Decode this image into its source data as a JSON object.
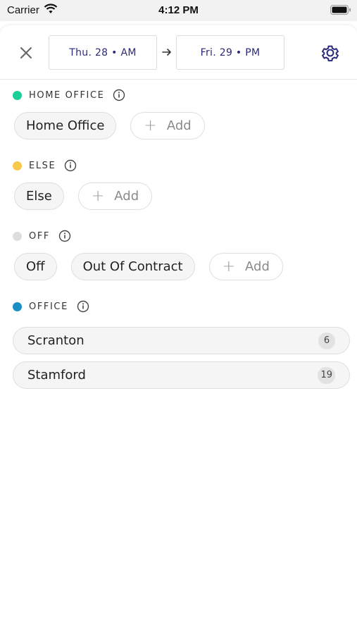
{
  "status": {
    "carrier": "Carrier",
    "time": "4:12 PM"
  },
  "header": {
    "start_date": "Thu. 28 • AM",
    "end_date": "Fri. 29 • PM"
  },
  "sections": {
    "home_office": {
      "title": "HOME OFFICE",
      "color": "#1ccf98",
      "chips": [
        "Home Office"
      ],
      "add_label": "Add"
    },
    "else": {
      "title": "ELSE",
      "color": "#f7c948",
      "chips": [
        "Else"
      ],
      "add_label": "Add"
    },
    "off": {
      "title": "OFF",
      "color": "#dddddd",
      "chips": [
        "Off",
        "Out Of Contract"
      ],
      "add_label": "Add"
    },
    "office": {
      "title": "OFFICE",
      "color": "#1a8fc4",
      "rows": [
        {
          "name": "Scranton",
          "count": "6"
        },
        {
          "name": "Stamford",
          "count": "19"
        }
      ]
    }
  },
  "colors": {
    "accent": "#2b2a7a"
  }
}
